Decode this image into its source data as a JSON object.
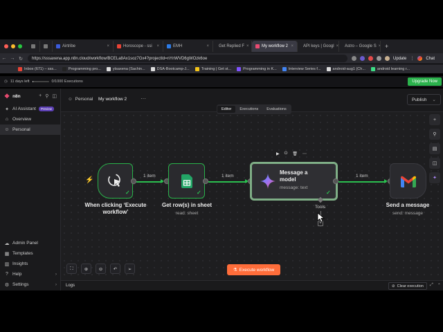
{
  "browser": {
    "tabs": [
      {
        "label": "",
        "icon": "grid-icon",
        "color": "#777777"
      },
      {
        "label": "",
        "icon": "globe-icon",
        "color": "#777777"
      },
      {
        "label": "Airtribe",
        "icon": "airtribe-icon",
        "color": "#3b5bdb"
      },
      {
        "label": "Horoscope - ssi",
        "icon": "gmail-icon",
        "color": "#ea4335"
      },
      {
        "label": "EMH",
        "icon": "emh-icon",
        "color": "#2c7be5"
      },
      {
        "label": "Get Replied F",
        "icon": "sheet-icon",
        "color": "#34a853"
      },
      {
        "label": "My workflow 2",
        "icon": "n8n-icon",
        "color": "#ea4b71",
        "active": true
      },
      {
        "label": "API keys | Googl",
        "icon": "google-icon",
        "color": "#4285f4"
      },
      {
        "label": "Astro – Google S",
        "icon": "sheet-icon",
        "color": "#34a853"
      }
    ],
    "new_tab": "+",
    "url": "https://sssaxena.app.n8n.cloud/workflow/BCELa8Ax1soz7Gx4?projectId=nYnWVD6gWOzk6oe",
    "update_label": "Update",
    "chat_label": "Chat",
    "bookmarks": [
      {
        "label": "Inbox (671) – sss...",
        "color": "#ea4335"
      },
      {
        "label": "Programming pro...",
        "color": "#222222"
      },
      {
        "label": "ytsaxena (Sachin...",
        "color": "#dddddd"
      },
      {
        "label": "DSA-Bootcamp-J...",
        "color": "#dddddd"
      },
      {
        "label": "Training | Get st...",
        "color": "#f5c518"
      },
      {
        "label": "Programming in K...",
        "color": "#7f52ff"
      },
      {
        "label": "Interview Series f...",
        "color": "#4285f4"
      },
      {
        "label": "android-aug1 (Ch...",
        "color": "#dddddd"
      },
      {
        "label": "android learning r...",
        "color": "#3ddc84"
      }
    ]
  },
  "trial": {
    "days_left": "11 days left",
    "executions": "0/1000 Executions",
    "progress": 0.0,
    "upgrade_label": "Upgrade Now"
  },
  "sidebar": {
    "brand": "n8n",
    "items": [
      {
        "label": "AI Assistant",
        "badge": "Preview",
        "icon": "sparkle-icon"
      },
      {
        "label": "Overview",
        "icon": "home-icon"
      },
      {
        "label": "Personal",
        "icon": "user-icon",
        "active": true
      }
    ],
    "bottom_items": [
      {
        "label": "Admin Panel",
        "icon": "cloud-icon"
      },
      {
        "label": "Templates",
        "icon": "templates-icon"
      },
      {
        "label": "Insights",
        "icon": "chart-icon"
      },
      {
        "label": "Help",
        "icon": "help-icon",
        "chevron": true
      },
      {
        "label": "Settings",
        "icon": "gear-icon",
        "chevron": true
      }
    ]
  },
  "header": {
    "breadcrumb": "Personal",
    "workflow_name": "My workflow 2",
    "more": "···",
    "publish_label": "Publish",
    "tabs": [
      "Editor",
      "Executions",
      "Evaluations"
    ],
    "selected_tab": "Editor"
  },
  "workflow": {
    "nodes": [
      {
        "id": "trigger",
        "title": "When clicking ‘Execute workflow’",
        "subtitle": ""
      },
      {
        "id": "sheets",
        "title": "Get row(s) in sheet",
        "subtitle": "read: sheet"
      },
      {
        "id": "model",
        "title": "Message a model",
        "subtitle": "message: text",
        "tools_label": "Tools"
      },
      {
        "id": "gmail",
        "title": "Send a message",
        "subtitle": "send: message"
      }
    ],
    "edges": [
      {
        "label": "1 item"
      },
      {
        "label": "1 item"
      },
      {
        "label": "1 item"
      }
    ],
    "execute_label": "Execute workflow"
  },
  "logs": {
    "title": "Logs",
    "clear_label": "Clear execution"
  }
}
